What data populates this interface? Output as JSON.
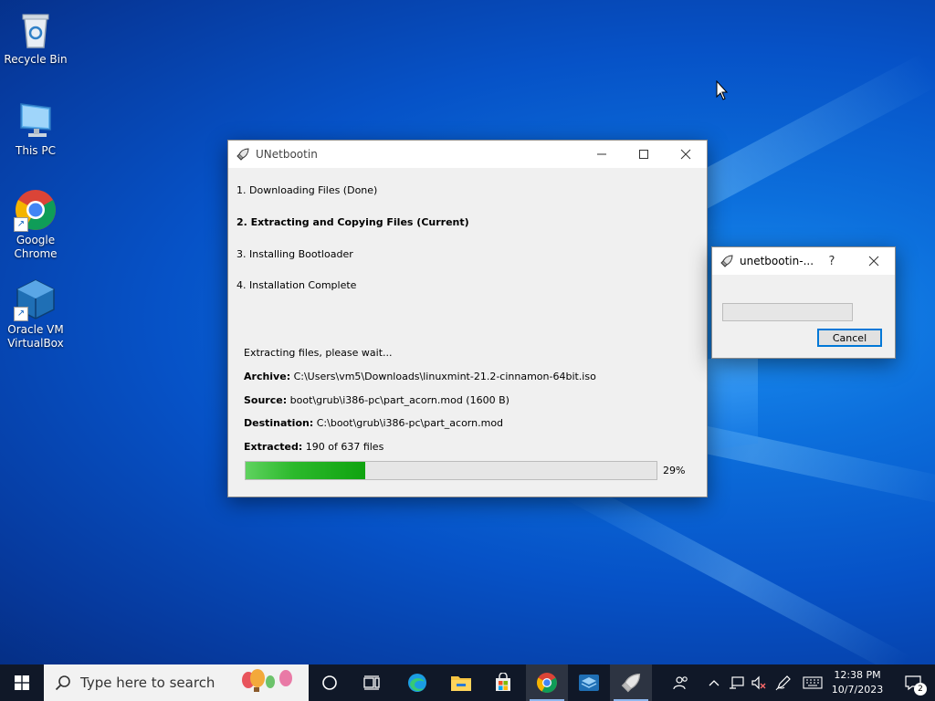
{
  "desktop": {
    "icons": [
      {
        "label": "Recycle Bin"
      },
      {
        "label": "This PC"
      },
      {
        "label": "Google Chrome"
      },
      {
        "label": "Oracle VM VirtualBox"
      }
    ]
  },
  "main_window": {
    "title": "UNetbootin",
    "steps": [
      "1. Downloading Files (Done)",
      "2. Extracting and Copying Files (Current)",
      "3. Installing Bootloader",
      "4. Installation Complete"
    ],
    "status": "Extracting files, please wait...",
    "archive_label": "Archive:",
    "archive_value": "C:\\Users\\vm5\\Downloads\\linuxmint-21.2-cinnamon-64bit.iso",
    "source_label": "Source:",
    "source_value": "boot\\grub\\i386-pc\\part_acorn.mod (1600 B)",
    "destination_label": "Destination:",
    "destination_value": "C:\\boot\\grub\\i386-pc\\part_acorn.mod",
    "extracted_label": "Extracted:",
    "extracted_value": "190 of 637 files",
    "progress_percent": 29,
    "progress_text": "29%"
  },
  "dialog": {
    "title": "unetbootin-...",
    "help_label": "?",
    "cancel_label": "Cancel"
  },
  "taskbar": {
    "search_placeholder": "Type here to search",
    "time": "12:38 PM",
    "date": "10/7/2023",
    "notification_count": "2"
  },
  "colors": {
    "progress": "#0fa30f",
    "taskbar": "#101828",
    "focus": "#0078d7"
  }
}
